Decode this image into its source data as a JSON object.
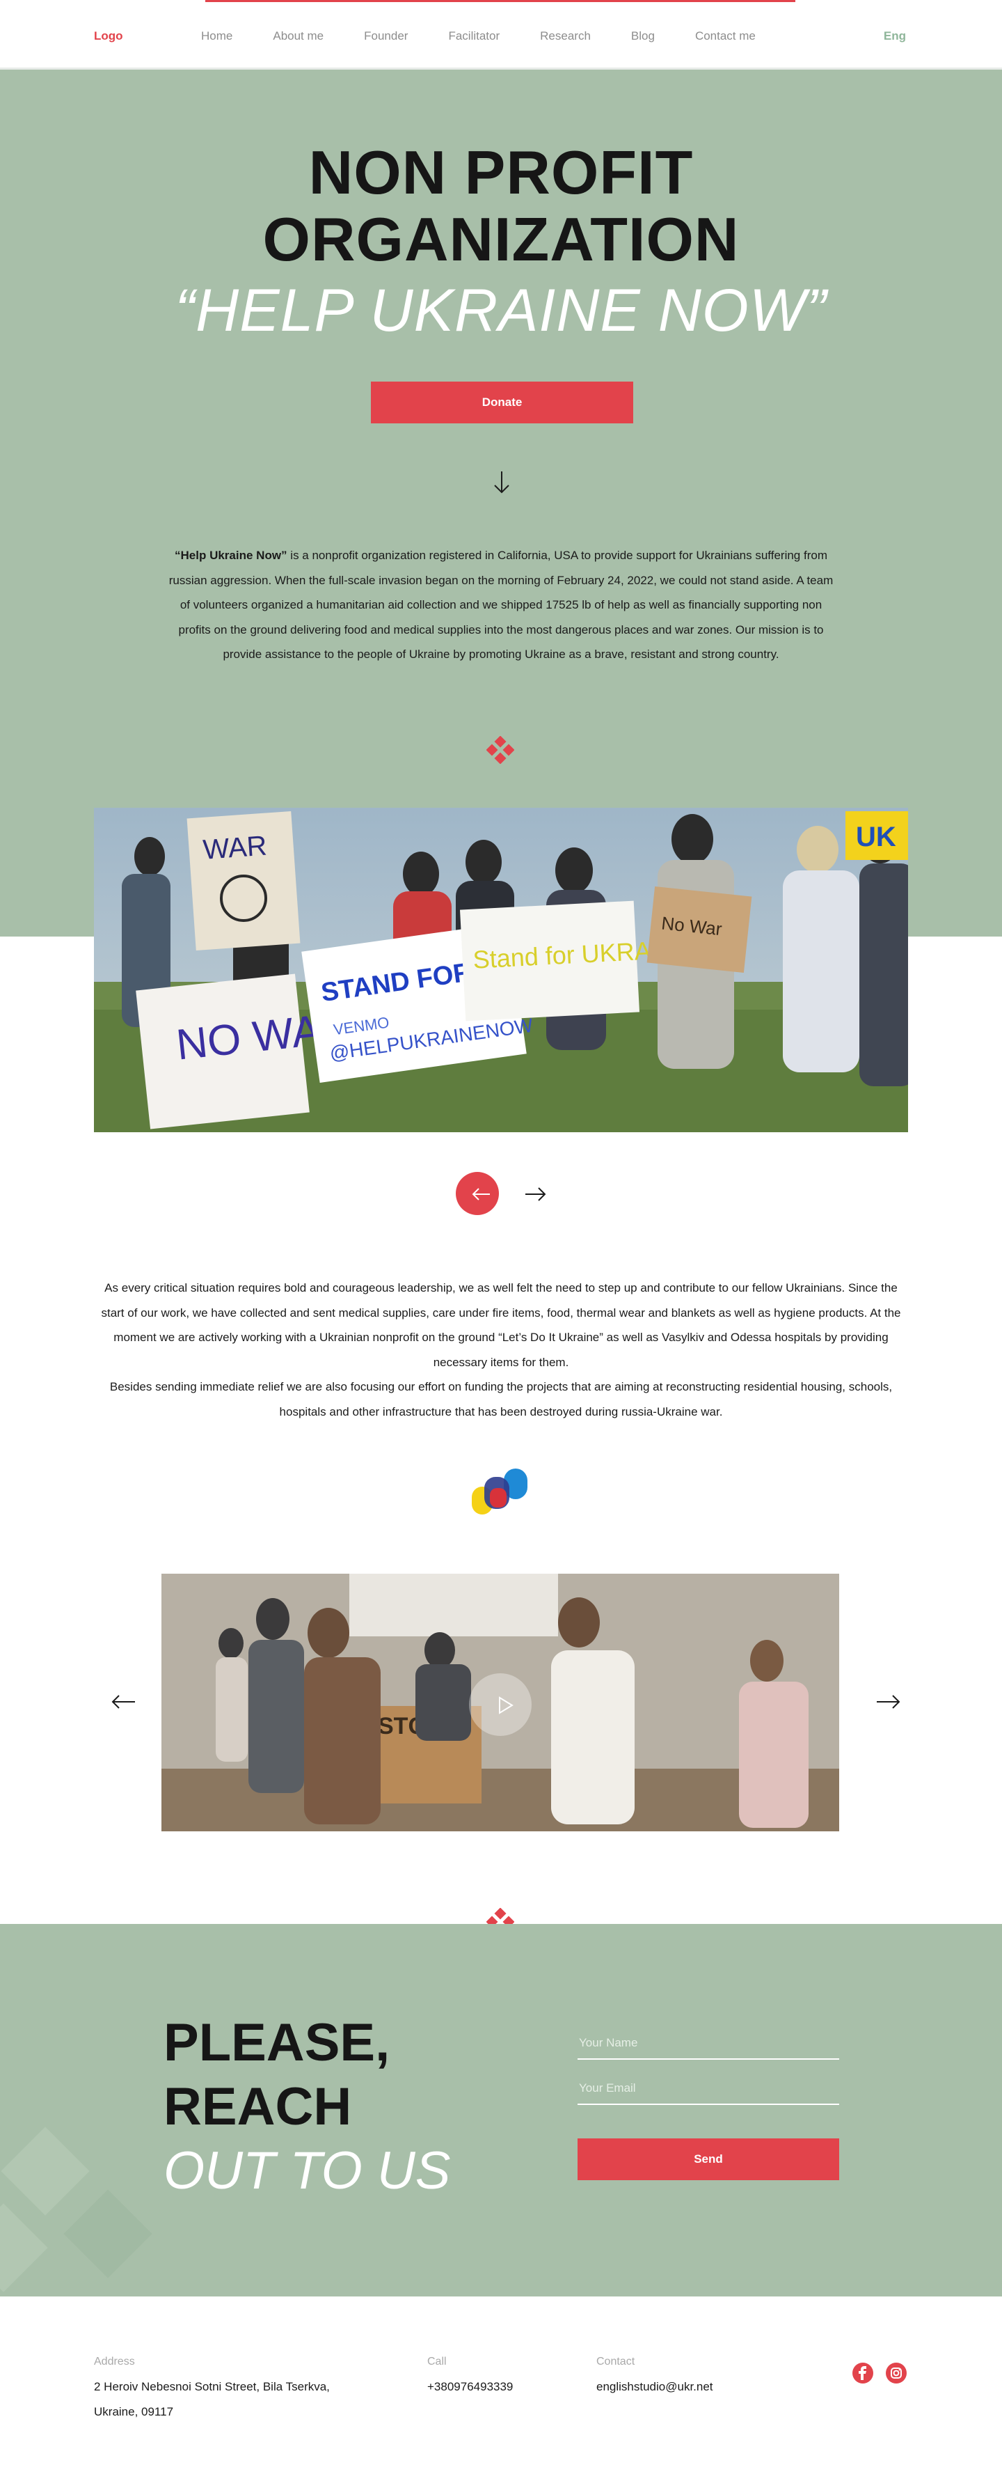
{
  "nav": {
    "logo": "Logo",
    "items": [
      "Home",
      "About me",
      "Founder",
      "Facilitator",
      "Research",
      "Blog",
      "Contact me"
    ],
    "lang": "Eng"
  },
  "hero": {
    "title_line1": "NON PROFIT",
    "title_line2": "ORGANIZATION",
    "subtitle": "“HELP UKRAINE NOW”",
    "donate_label": "Donate",
    "intro_bold": "“Help Ukraine Now”",
    "intro_rest": " is a nonprofit organization registered in California, USA to provide support for Ukrainians suffering from russian aggression. When the full-scale invasion began on the morning of February 24, 2022, we could not stand aside. A team of volunteers organized a humanitarian aid collection and we shipped 17525 lb of help as well as financially supporting non profits on the ground delivering food and medical supplies into the most dangerous places and war zones. Our mission is to provide assistance to the people of Ukraine by promoting Ukraine as a brave, resistant and strong country."
  },
  "gallery": {
    "signs": [
      "WAR",
      "STAND FOR UKRAINE",
      "VENMO",
      "@HELPUKRAINENOW",
      "Stand for UKRAINE",
      "NO WAR",
      "No War",
      "UK"
    ]
  },
  "about": {
    "p1": "As every critical situation requires bold and courageous leadership, we as well felt the need to step up and contribute to our fellow Ukrainians. Since the start of our work, we have collected and sent medical supplies, care under fire items, food, thermal wear and blankets as well as hygiene products. At the moment we are actively working with a Ukrainian nonprofit on the ground “Let’s Do It Ukraine” as well as Vasylkiv and Odessa hospitals by providing necessary items for them.",
    "p2": "Besides sending immediate relief we are also focusing our effort on funding the projects that are aiming at reconstructing residential housing, schools, hospitals and other infrastructure that has been destroyed during russia-Ukraine war."
  },
  "video": {
    "box_text": "COSTCO"
  },
  "contact": {
    "line1": "PLEASE,",
    "line2": "REACH",
    "line3": "OUT TO US",
    "name_placeholder": "Your Name",
    "email_placeholder": "Your Email",
    "send_label": "Send"
  },
  "footer": {
    "address_label": "Address",
    "address_line1": "2 Heroiv Nebesnoi Sotni Street, Bila Tserkva,",
    "address_line2": "Ukraine, 09117",
    "call_label": "Call",
    "phone": "+380976493339",
    "contact_label": "Contact",
    "email": "englishstudio@ukr.net"
  },
  "icons": [
    "arrow-down-icon",
    "arrow-left-icon",
    "arrow-right-icon",
    "play-icon",
    "ornament-icon",
    "facebook-icon",
    "instagram-icon"
  ],
  "colors": {
    "accent": "#e2434b",
    "hero_bg": "#a8bfa9",
    "lang": "#8fb69a"
  }
}
